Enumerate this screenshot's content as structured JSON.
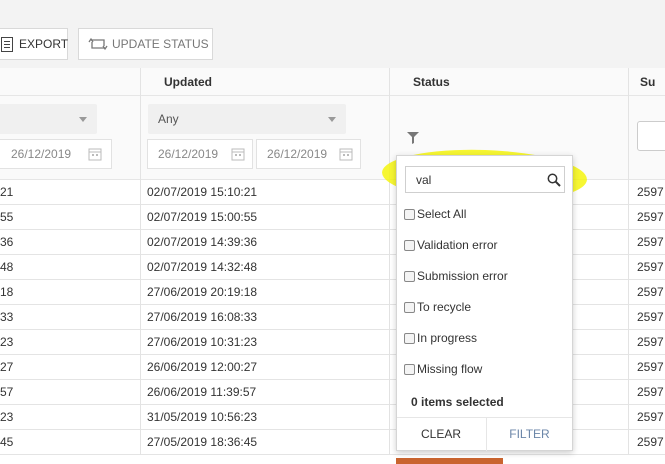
{
  "toolbar": {
    "export_label": "EXPORT",
    "update_status_label": "UPDATE STATUS"
  },
  "columns": {
    "updated": "Updated",
    "status": "Status",
    "sum_partial": "Su"
  },
  "filters": {
    "left_date_to": "26/12/2019",
    "updated_select": "Any",
    "updated_date_from": "26/12/2019",
    "updated_date_to": "26/12/2019"
  },
  "rows": [
    {
      "left": "21",
      "updated": "02/07/2019 15:10:21",
      "sum": "2597"
    },
    {
      "left": "55",
      "updated": "02/07/2019 15:00:55",
      "sum": "2597"
    },
    {
      "left": "36",
      "updated": "02/07/2019 14:39:36",
      "sum": "2597"
    },
    {
      "left": "48",
      "updated": "02/07/2019 14:32:48",
      "sum": "2597"
    },
    {
      "left": "18",
      "updated": "27/06/2019 20:19:18",
      "sum": "2597"
    },
    {
      "left": "33",
      "updated": "27/06/2019 16:08:33",
      "sum": "2597"
    },
    {
      "left": "23",
      "updated": "27/06/2019 10:31:23",
      "sum": "2597"
    },
    {
      "left": "27",
      "updated": "26/06/2019 12:00:27",
      "sum": "2597"
    },
    {
      "left": "57",
      "updated": "26/06/2019 11:39:57",
      "sum": "2597"
    },
    {
      "left": "23",
      "updated": "31/05/2019 10:56:23",
      "sum": "2597"
    },
    {
      "left": "45",
      "updated": "27/05/2019 18:36:45",
      "sum": "2597"
    }
  ],
  "status_filter": {
    "search_value": "val",
    "options": [
      "Select All",
      "Validation error",
      "Submission error",
      "To recycle",
      "In progress",
      "Missing flow"
    ],
    "selected_count": "0 items selected",
    "clear_label": "CLEAR",
    "filter_label": "FILTER"
  },
  "icons": {
    "export": "document-icon",
    "update_status": "cycle-arrows-icon",
    "calendar": "calendar-icon",
    "filter": "funnel-icon",
    "search": "magnifier-icon"
  },
  "colors": {
    "highlight": "#f5f500",
    "filter_button": "#6b86a8",
    "accent_bar": "#c9642f"
  }
}
